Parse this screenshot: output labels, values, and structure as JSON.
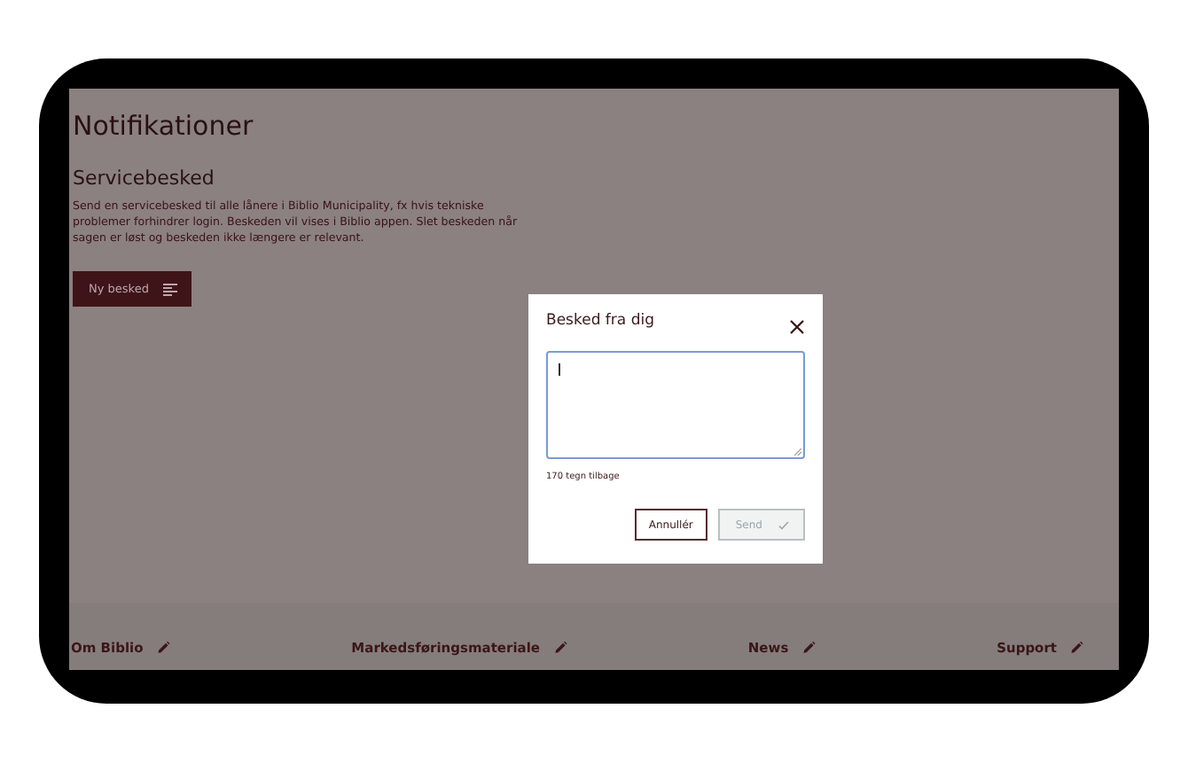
{
  "page": {
    "title": "Notifikationer",
    "section_title": "Servicebesked",
    "description": "Send en servicebesked til alle lånere i Biblio Municipality, fx hvis tekniske problemer forhindrer login. Beskeden vil vises i Biblio appen. Slet beskeden når sagen er løst og beskeden ikke længere er relevant.",
    "new_button": "Ny besked"
  },
  "footer_links": [
    {
      "label": "Om Biblio"
    },
    {
      "label": "Markedsføringsmateriale"
    },
    {
      "label": "News"
    },
    {
      "label": "Support"
    }
  ],
  "dialog": {
    "title": "Besked fra dig",
    "counter": "170 tegn tilbage",
    "buttons": [
      {
        "label": "Annullér",
        "kind": "cancel",
        "disabled": false
      },
      {
        "label": "Send",
        "kind": "confirm",
        "disabled": true
      }
    ]
  }
}
